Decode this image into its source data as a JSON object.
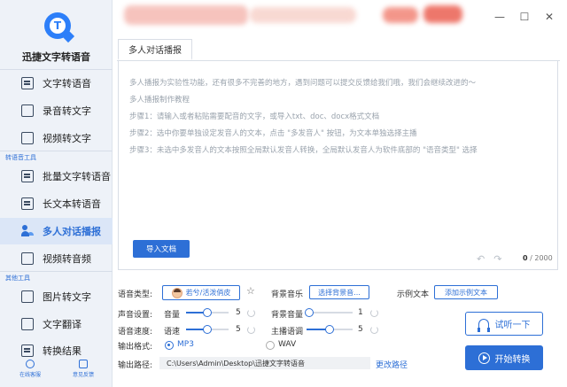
{
  "app": {
    "name": "迅捷文字转语音",
    "logo_letter": "T"
  },
  "sidebar": {
    "items": [
      {
        "label": "文字转语音"
      },
      {
        "label": "录音转文字"
      },
      {
        "label": "视频转文字"
      }
    ],
    "section_tts": "转语音工具",
    "tts_items": [
      {
        "label": "批量文字转语音"
      },
      {
        "label": "长文本转语音"
      },
      {
        "label": "多人对话播报"
      },
      {
        "label": "视频转音频"
      }
    ],
    "section_other": "其他工具",
    "other_items": [
      {
        "label": "图片转文字"
      },
      {
        "label": "文字翻译"
      },
      {
        "label": "转换结果"
      }
    ],
    "bottom": [
      {
        "label": "在线客服"
      },
      {
        "label": "意见反馈"
      }
    ]
  },
  "window": {
    "minimize": "—",
    "maximize": "☐",
    "close": "✕"
  },
  "tab": {
    "label": "多人对话播报"
  },
  "editor": {
    "hints": [
      "多人播报为实验性功能，还有很多不完善的地方，遇到问题可以提交反馈给我们哦，我们会继续改进的～",
      "多人播报制作教程",
      "步骤1：请输入或者粘贴需要配音的文字，或导入txt、doc、docx格式文档",
      "步骤2：选中你要单独设定发音人的文本，点击 \"多发音人\" 按钮，为文本单独选择主播",
      "步骤3：未选中多发音人的文本按照全局默认发音人转换，全局默认发音人为软件底部的 \"语音类型\" 选择"
    ],
    "import_label": "导入文档",
    "undo": "↶",
    "redo": "↷",
    "count": "0",
    "max": "/ 2000"
  },
  "settings": {
    "voice_type_label": "语音类型:",
    "voice_type_value": "若兮/活泼俏皮",
    "bgm_label": "背景音乐",
    "bgm_button": "选择背景音...",
    "sample_label": "示例文本",
    "sample_button": "添加示例文本",
    "sound_label": "声音设置:",
    "volume_label": "音量",
    "volume_value": "5",
    "volume_fraction": 0.5,
    "bg_volume_label": "背景音量",
    "bg_volume_value": "1",
    "bg_volume_fraction": 0.06,
    "speed_section_label": "语音速度:",
    "speed_label": "语速",
    "speed_value": "5",
    "speed_fraction": 0.5,
    "tone_label": "主播语调",
    "tone_value": "5",
    "tone_fraction": 0.5,
    "format_label": "输出格式:",
    "format_mp3": "MP3",
    "format_wav": "WAV",
    "path_label": "输出路径:",
    "path_value": "C:\\Users\\Admin\\Desktop\\迅捷文字转语音",
    "change_path": "更改路径"
  },
  "actions": {
    "try_label": "试听一下",
    "start_label": "开始转换"
  }
}
